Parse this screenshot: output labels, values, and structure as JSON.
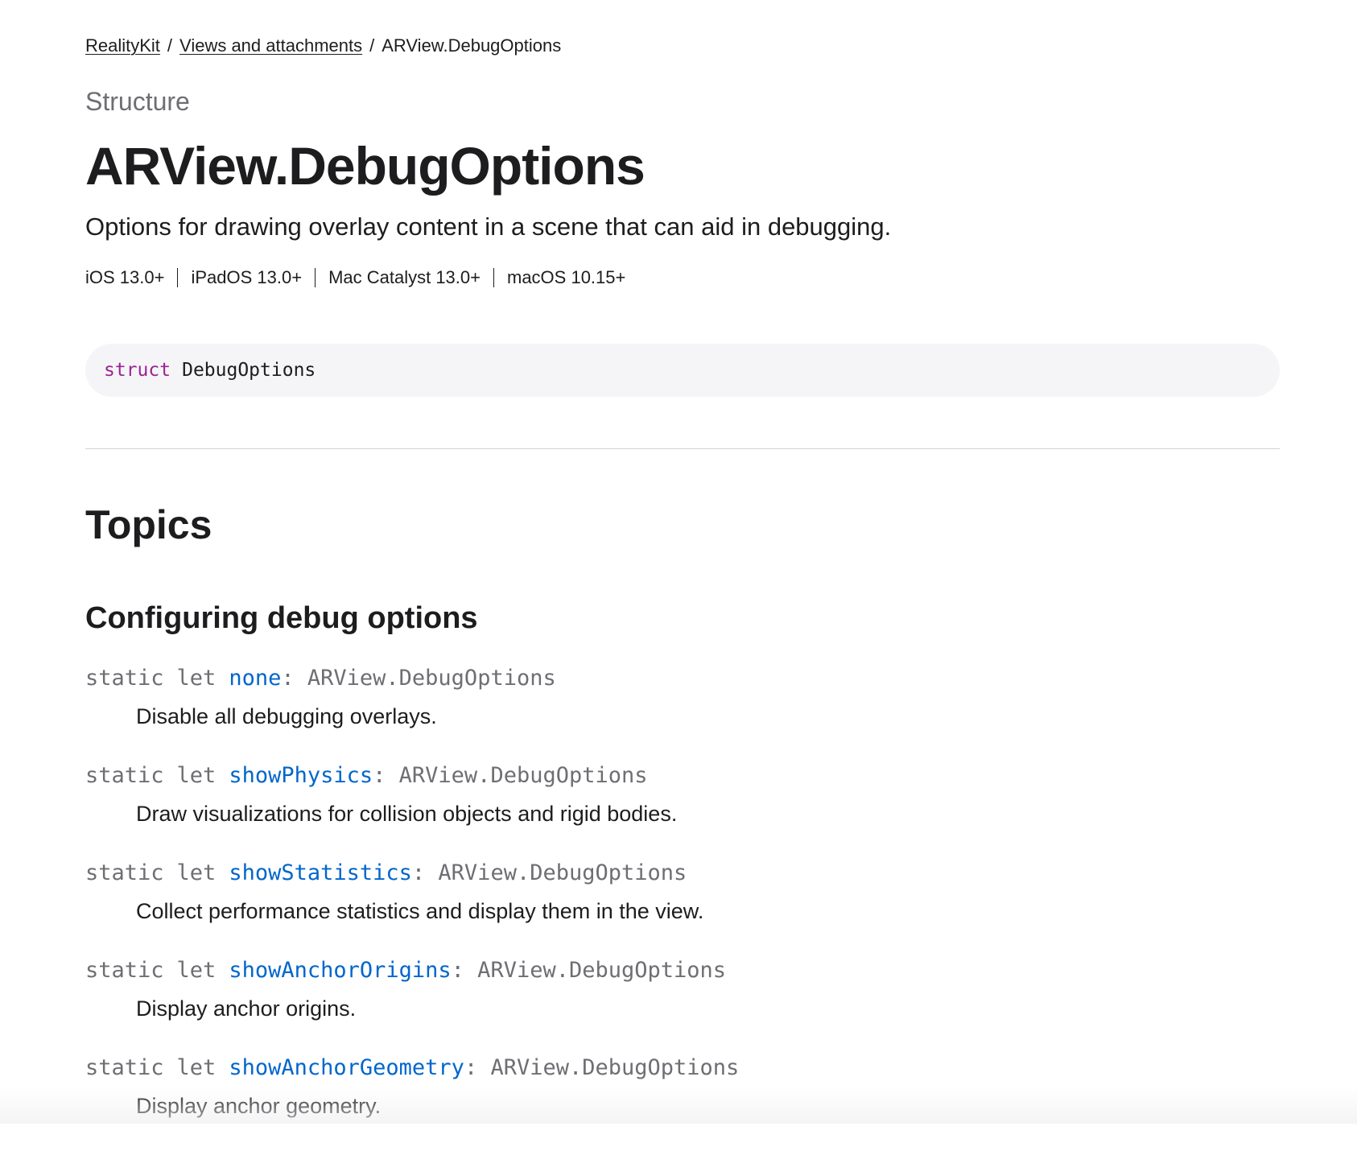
{
  "breadcrumb": {
    "items": [
      {
        "label": "RealityKit"
      },
      {
        "label": "Views and attachments"
      }
    ],
    "current": "ARView.DebugOptions",
    "separator": "/"
  },
  "header": {
    "eyebrow": "Structure",
    "title": "ARView.DebugOptions",
    "abstract": "Options for drawing overlay content in a scene that can aid in debugging."
  },
  "platforms": [
    "iOS 13.0+",
    "iPadOS 13.0+",
    "Mac Catalyst 13.0+",
    "macOS 10.15+"
  ],
  "declaration": {
    "keyword": "struct",
    "name": "DebugOptions"
  },
  "topics": {
    "heading": "Topics",
    "groups": [
      {
        "heading": "Configuring debug options",
        "items": [
          {
            "prefix1": "static",
            "prefix2": "let",
            "name": "none",
            "type": ": ARView.DebugOptions",
            "description": "Disable all debugging overlays."
          },
          {
            "prefix1": "static",
            "prefix2": "let",
            "name": "showPhysics",
            "type": ": ARView.DebugOptions",
            "description": "Draw visualizations for collision objects and rigid bodies."
          },
          {
            "prefix1": "static",
            "prefix2": "let",
            "name": "showStatistics",
            "type": ": ARView.DebugOptions",
            "description": "Collect performance statistics and display them in the view."
          },
          {
            "prefix1": "static",
            "prefix2": "let",
            "name": "showAnchorOrigins",
            "type": ": ARView.DebugOptions",
            "description": "Display anchor origins."
          },
          {
            "prefix1": "static",
            "prefix2": "let",
            "name": "showAnchorGeometry",
            "type": ": ARView.DebugOptions",
            "description": "Display anchor geometry."
          }
        ]
      }
    ]
  },
  "colors": {
    "link": "#0066cc",
    "keyword": "#9b2393",
    "secondary_text": "#6e6e73",
    "declaration_bg": "#f5f5f7"
  }
}
